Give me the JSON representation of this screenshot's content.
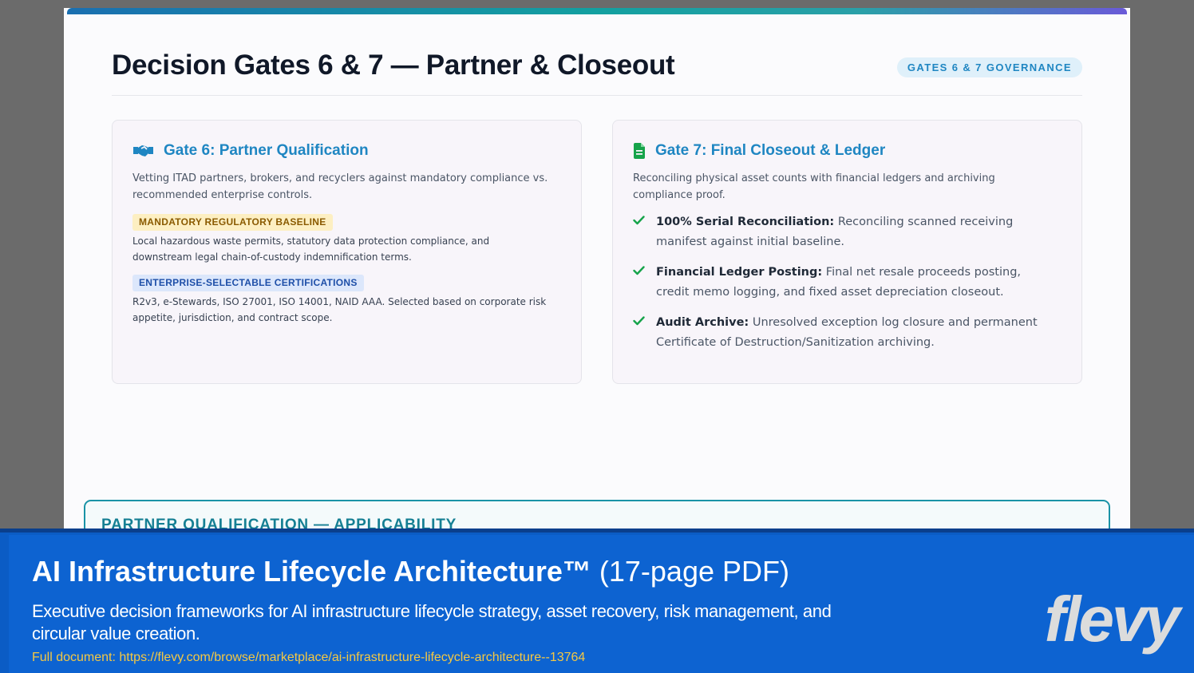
{
  "slide": {
    "title": "Decision Gates 6 & 7 — Partner & Closeout",
    "badge": "GATES 6 & 7 GOVERNANCE",
    "gate6": {
      "icon": "handshake-icon",
      "title": "Gate 6: Partner Qualification",
      "description": "Vetting ITAD partners, brokers, and recyclers against mandatory compliance vs. recommended enterprise controls.",
      "mandatory_tag": "MANDATORY REGULATORY BASELINE",
      "mandatory_text": "Local hazardous waste permits, statutory data protection compliance, and downstream legal chain-of-custody indemnification terms.",
      "enterprise_tag": "ENTERPRISE-SELECTABLE CERTIFICATIONS",
      "enterprise_text": "R2v3, e-Stewards, ISO 27001, ISO 14001, NAID AAA. Selected based on corporate risk appetite, jurisdiction, and contract scope."
    },
    "gate7": {
      "icon": "document-icon",
      "title": "Gate 7: Final Closeout & Ledger",
      "description": "Reconciling physical asset counts with financial ledgers and archiving compliance proof.",
      "items": [
        {
          "label": "100% Serial Reconciliation:",
          "text": "Reconciling scanned receiving manifest against initial baseline."
        },
        {
          "label": "Financial Ledger Posting:",
          "text": "Final net resale proceeds posting, credit memo logging, and fixed asset depreciation closeout."
        },
        {
          "label": "Audit Archive:",
          "text": "Unresolved exception log closure and permanent Certificate of Destruction/Sanitization archiving."
        }
      ]
    },
    "applicability_title": "PARTNER QUALIFICATION — APPLICABILITY"
  },
  "footer": {
    "title_bold": "AI Infrastructure Lifecycle Architecture™",
    "title_suffix": "(17-page PDF)",
    "description": "Executive decision frameworks for AI infrastructure lifecycle strategy, asset recovery, risk management, and circular value creation.",
    "link": "Full document: https://flevy.com/browse/marketplace/ai-infrastructure-lifecycle-architecture--13764",
    "logo": "flevy"
  },
  "colors": {
    "accent_blue": "#1f86c2",
    "check_green": "#16a34a",
    "footer_blue": "#0d63d1",
    "link_yellow": "#f5c842"
  }
}
